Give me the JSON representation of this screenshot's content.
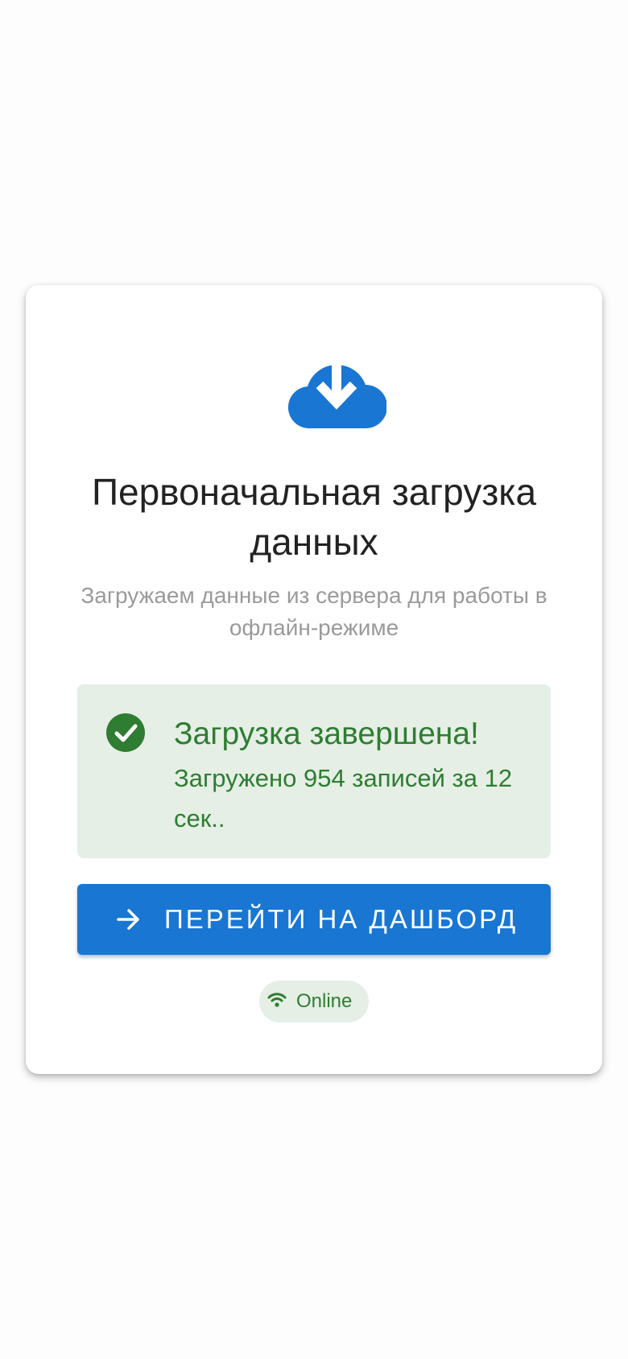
{
  "colors": {
    "primary": "#1976d2",
    "success": "#2e7d32",
    "success_background": "#e5efe5",
    "title_text": "#222222",
    "subtitle_text": "#9a9a9a"
  },
  "header": {
    "icon": "cloud-download-icon",
    "title": "Первоначальная загрузка данных",
    "subtitle": "Загружаем данные из сервера для работы в офлайн-режиме"
  },
  "alert": {
    "icon": "check-circle-icon",
    "title": "Загрузка завершена!",
    "message": "Загружено 954 записей за 12 сек.."
  },
  "action": {
    "icon": "arrow-right-icon",
    "label": "ПЕРЕЙТИ НА ДАШБОРД"
  },
  "status": {
    "icon": "wifi-icon",
    "label": "Online"
  }
}
